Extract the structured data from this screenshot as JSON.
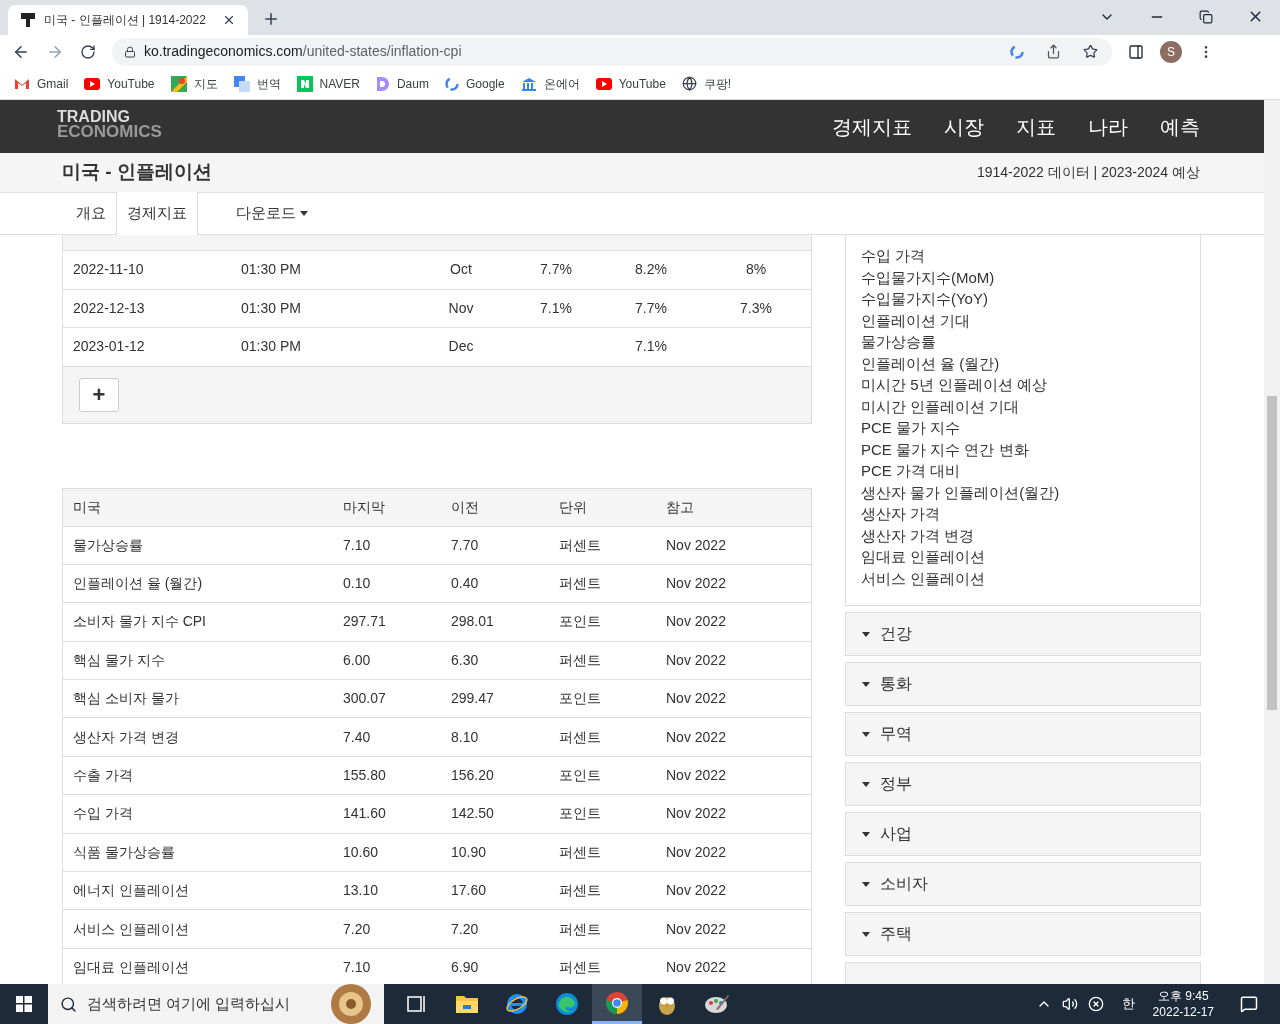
{
  "browser": {
    "tab": {
      "title": "미국 - 인플레이션 | 1914-2022",
      "selected": true
    },
    "url_host": "ko.tradingeconomics.com",
    "url_path": "/united-states/inflation-cpi",
    "profile_initial": "S",
    "bookmarks": [
      "Gmail",
      "YouTube",
      "지도",
      "번역",
      "NAVER",
      "Daum",
      "Google",
      "온에어",
      "YouTube",
      "쿠팡!"
    ]
  },
  "site": {
    "logo_top": "TRADING",
    "logo_bottom": "ECONOMICS",
    "nav": [
      "경제지표",
      "시장",
      "지표",
      "나라",
      "예측"
    ],
    "page_title": "미국 - 인플레이션",
    "data_range": "1914-2022 데이터 | 2023-2024 예상",
    "subtabs": [
      {
        "label": "개요",
        "selected": false,
        "kind": "link"
      },
      {
        "label": "경제지표",
        "selected": true,
        "kind": "link"
      },
      {
        "label": "다운로드",
        "selected": false,
        "kind": "dropdown"
      }
    ]
  },
  "calendar": {
    "rows": [
      {
        "date": "2022-11-10",
        "time": "01:30 PM",
        "reference": "Oct",
        "actual": "7.7%",
        "previous": "8.2%",
        "consensus": "8%"
      },
      {
        "date": "2022-12-13",
        "time": "01:30 PM",
        "reference": "Nov",
        "actual": "7.1%",
        "previous": "7.7%",
        "consensus": "7.3%"
      },
      {
        "date": "2023-01-12",
        "time": "01:30 PM",
        "reference": "Dec",
        "actual": "",
        "previous": "7.1%",
        "consensus": ""
      }
    ],
    "add_button": "+"
  },
  "related": {
    "columns": [
      "미국",
      "마지막",
      "이전",
      "단위",
      "참고"
    ],
    "rows": [
      [
        "물가상승률",
        "7.10",
        "7.70",
        "퍼센트",
        "Nov 2022"
      ],
      [
        "인플레이션 율 (월간)",
        "0.10",
        "0.40",
        "퍼센트",
        "Nov 2022"
      ],
      [
        "소비자 물가 지수 CPI",
        "297.71",
        "298.01",
        "포인트",
        "Nov 2022"
      ],
      [
        "핵심 물가 지수",
        "6.00",
        "6.30",
        "퍼센트",
        "Nov 2022"
      ],
      [
        "핵심 소비자 물가",
        "300.07",
        "299.47",
        "포인트",
        "Nov 2022"
      ],
      [
        "생산자 가격 변경",
        "7.40",
        "8.10",
        "퍼센트",
        "Nov 2022"
      ],
      [
        "수출 가격",
        "155.80",
        "156.20",
        "포인트",
        "Nov 2022"
      ],
      [
        "수입 가격",
        "141.60",
        "142.50",
        "포인트",
        "Nov 2022"
      ],
      [
        "식품 물가상승률",
        "10.60",
        "10.90",
        "퍼센트",
        "Nov 2022"
      ],
      [
        "에너지 인플레이션",
        "13.10",
        "17.60",
        "퍼센트",
        "Nov 2022"
      ],
      [
        "서비스 인플레이션",
        "7.20",
        "7.20",
        "퍼센트",
        "Nov 2022"
      ],
      [
        "임대료 인플레이션",
        "7.10",
        "6.90",
        "퍼센트",
        "Nov 2022"
      ]
    ]
  },
  "sidebar": {
    "links": [
      "수입 가격",
      "수입물가지수(MoM)",
      "수입물가지수(YoY)",
      "인플레이션 기대",
      "물가상승률",
      "인플레이션 율 (월간)",
      "미시간 5년 인플레이션 예상",
      "미시간 인플레이션 기대",
      "PCE 물가 지수",
      "PCE 물가 지수 연간 변화",
      "PCE 가격 대비",
      "생산자 물가 인플레이션(월간)",
      "생산자 가격",
      "생산자 가격 변경",
      "임대료 인플레이션",
      "서비스 인플레이션"
    ],
    "sections": [
      "건강",
      "통화",
      "무역",
      "정부",
      "사업",
      "소비자",
      "주택"
    ]
  },
  "taskbar": {
    "search_placeholder": "검색하려면 여기에 입력하십시",
    "apps": [
      {
        "selected": false
      },
      {
        "selected": false
      },
      {
        "selected": false
      },
      {
        "selected": false
      },
      {
        "selected": true
      },
      {
        "selected": false
      },
      {
        "selected": false
      }
    ],
    "ime": "한",
    "time": "오후 9:45",
    "date": "2022-12-17"
  }
}
